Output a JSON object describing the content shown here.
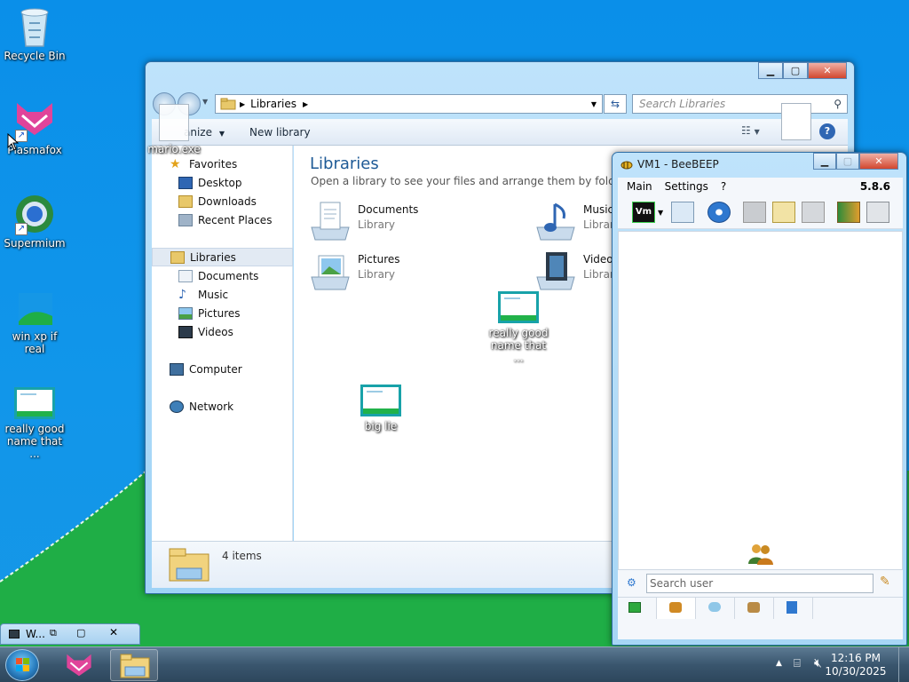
{
  "desktop": {
    "icons": [
      {
        "label": "Recycle Bin"
      },
      {
        "label": "Plasmafox"
      },
      {
        "label": "Supermium"
      },
      {
        "label": "win xp if real"
      },
      {
        "label": "really good name that ..."
      },
      {
        "label": "mario.exe"
      },
      {
        "label": "really good name that ..."
      },
      {
        "label": "big lie"
      }
    ]
  },
  "explorer": {
    "address": {
      "crumb": "Libraries"
    },
    "search": {
      "placeholder": "Search Libraries"
    },
    "toolbar": {
      "organize": "anize",
      "new_library": "New library"
    },
    "nav": {
      "favorites": "Favorites",
      "fav_items": [
        "Desktop",
        "Downloads",
        "Recent Places"
      ],
      "libraries": "Libraries",
      "lib_items": [
        "Documents",
        "Music",
        "Pictures",
        "Videos"
      ],
      "computer": "Computer",
      "network": "Network"
    },
    "content": {
      "title": "Libraries",
      "subtitle": "Open a library to see your files and arrange them by folder, date,",
      "libraries": [
        {
          "name": "Documents",
          "type": "Library"
        },
        {
          "name": "Music",
          "type": "Librar"
        },
        {
          "name": "Pictures",
          "type": "Library"
        },
        {
          "name": "Videos",
          "type": "Librar"
        }
      ]
    },
    "status": {
      "items": "4 items"
    }
  },
  "beebeep": {
    "title": "VM1 - BeeBEEP",
    "menu": {
      "main": "Main",
      "settings": "Settings",
      "help": "?"
    },
    "version": "5.8.6",
    "search": {
      "placeholder": "Search user"
    }
  },
  "minbar": {
    "label": "W..."
  },
  "taskbar": {
    "clock": {
      "time": "12:16 PM",
      "date": "10/30/2025"
    }
  },
  "colors": {
    "desktop_blue": "#0f8ee8",
    "hill_green": "#1fae46",
    "accent": "#1e72c4"
  }
}
